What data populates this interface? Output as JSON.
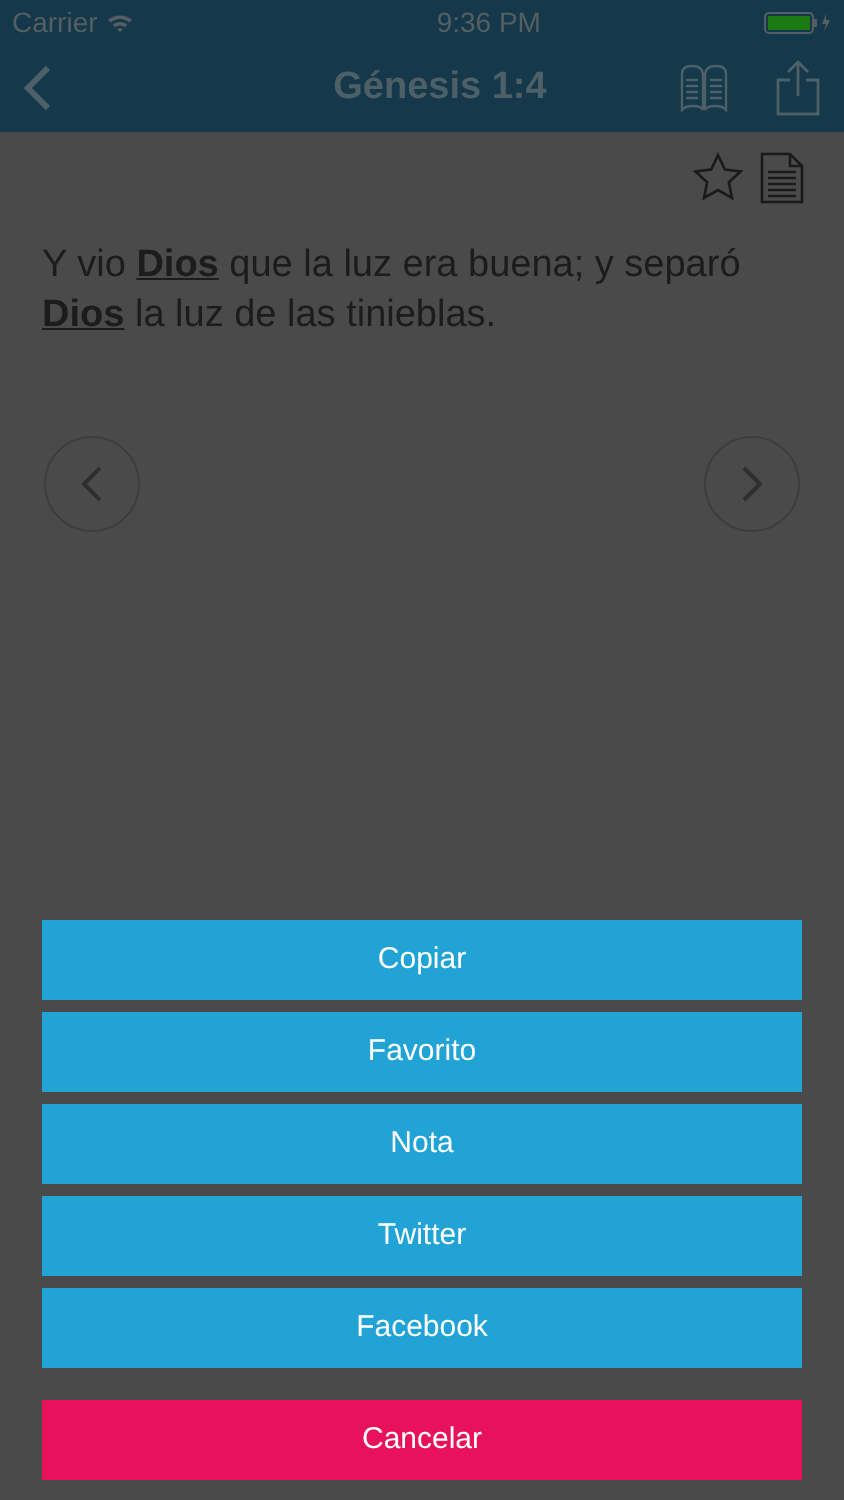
{
  "status_bar": {
    "carrier": "Carrier",
    "time": "9:36 PM"
  },
  "nav_bar": {
    "title": "Génesis 1:4"
  },
  "verse": {
    "text": "Y vio **Dios** que la luz era buena; y separó **Dios** la luz de las tinieblas."
  },
  "actions": [
    {
      "label": "Copiar",
      "kind": "action"
    },
    {
      "label": "Favorito",
      "kind": "action"
    },
    {
      "label": "Nota",
      "kind": "action"
    },
    {
      "label": "Twitter",
      "kind": "action"
    },
    {
      "label": "Facebook",
      "kind": "action"
    },
    {
      "label": "Cancelar",
      "kind": "cancel"
    }
  ]
}
